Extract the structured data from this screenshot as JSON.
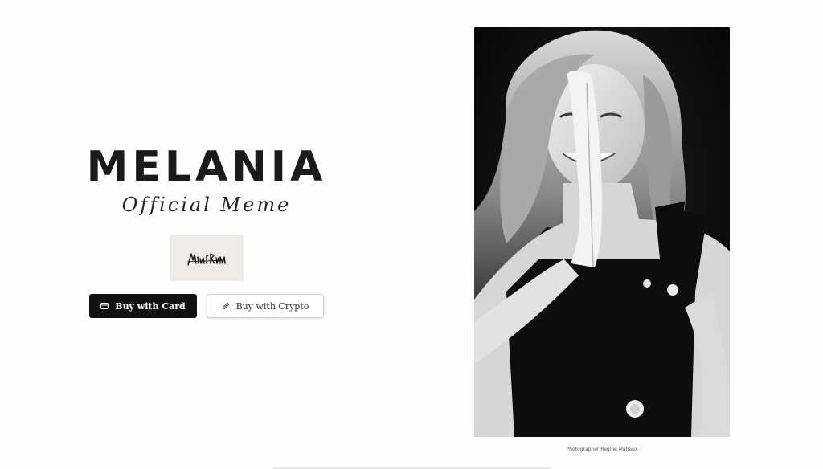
{
  "brand": {
    "title": "MELANIA",
    "subtitle": "Official Meme",
    "signature": "Melania Trump"
  },
  "buttons": {
    "card_label": "Buy with Card",
    "crypto_label": "Buy with Crypto"
  },
  "photo": {
    "alt": "Melania portrait",
    "caption": "Photographer Regine Mahaux"
  },
  "icons": {
    "card": "credit-card-icon",
    "crypto": "link-icon"
  },
  "colors": {
    "primary_button": "#111111",
    "text": "#1a1a1a",
    "signature_bg": "#eeece9"
  }
}
